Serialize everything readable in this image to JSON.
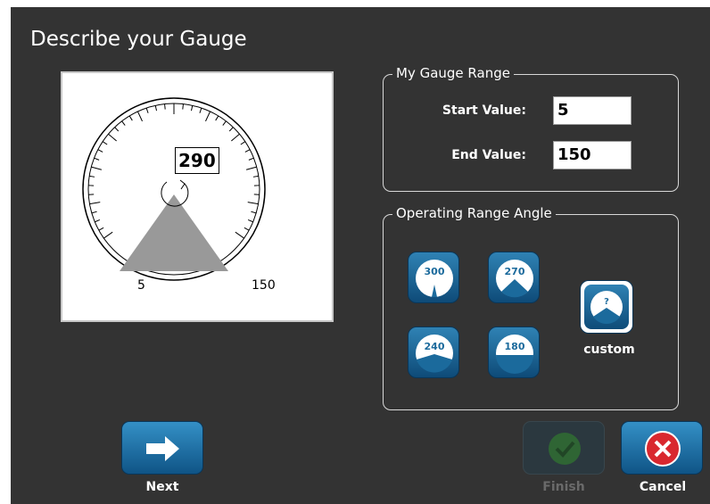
{
  "dialog": {
    "title": "Describe your Gauge"
  },
  "preview": {
    "angle_value": "290",
    "start_label": "5",
    "end_label": "150"
  },
  "range_group": {
    "legend": "My Gauge Range",
    "start_label": "Start Value:",
    "start_value": "5",
    "end_label": "End Value:",
    "end_value": "150"
  },
  "angle_group": {
    "legend": "Operating Range Angle",
    "options": [
      {
        "label": "300",
        "icon": "gauge-300-icon"
      },
      {
        "label": "270",
        "icon": "gauge-270-icon"
      },
      {
        "label": "240",
        "icon": "gauge-240-icon"
      },
      {
        "label": "180",
        "icon": "gauge-180-icon"
      }
    ],
    "custom_symbol": "?",
    "custom_label": "custom"
  },
  "buttons": {
    "next_label": "Next",
    "finish_label": "Finish",
    "cancel_label": "Cancel"
  },
  "colors": {
    "background": "#333333",
    "accent_blue": "#1b6a9c",
    "finish_green": "#2f6e35",
    "cancel_red": "#d9282f",
    "sector_gray": "#999999"
  }
}
